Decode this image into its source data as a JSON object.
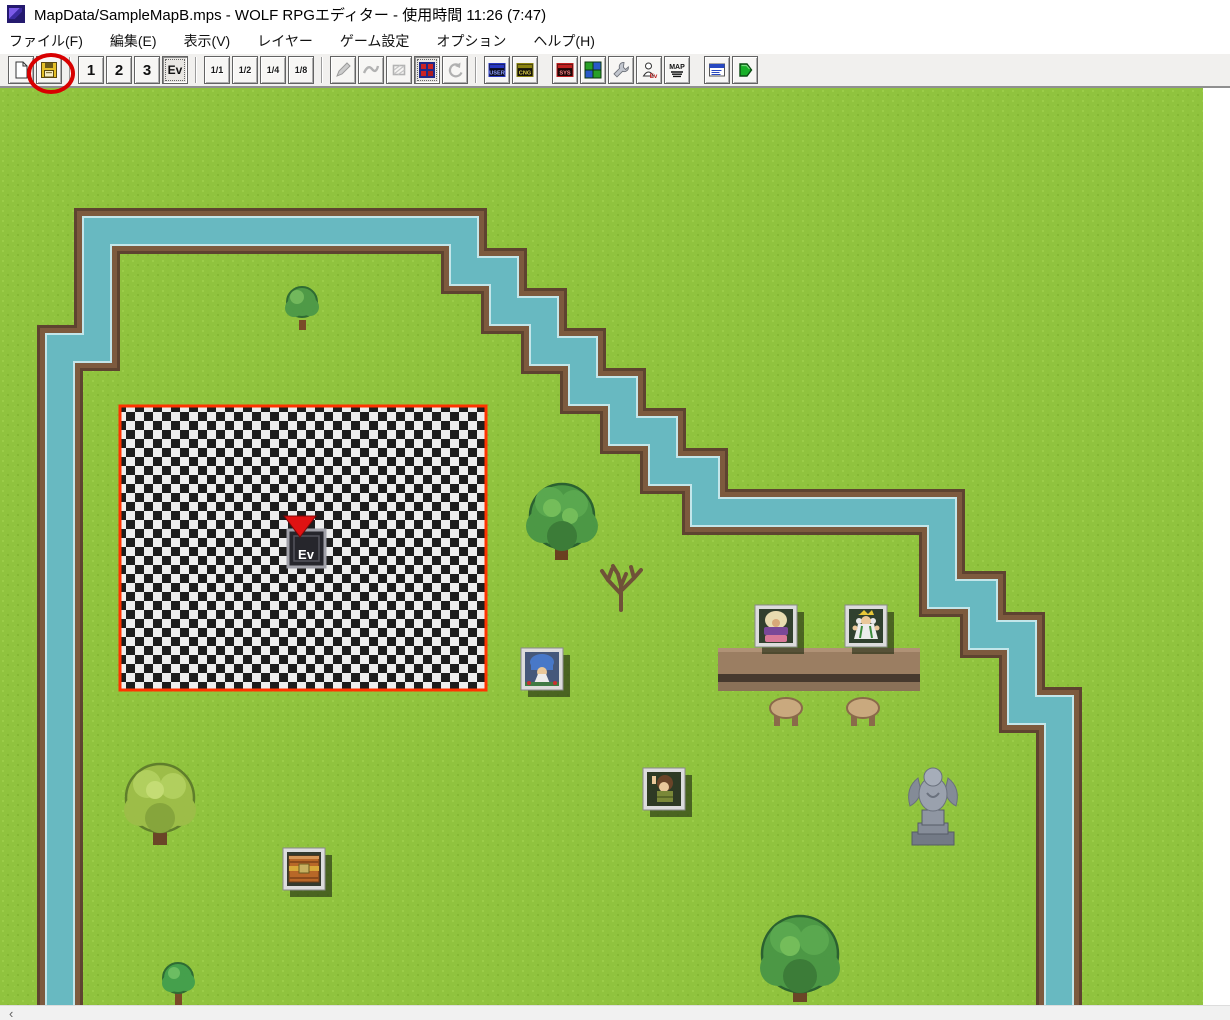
{
  "window": {
    "title": "MapData/SampleMapB.mps - WOLF RPGエディター - 使用時間 11:26 (7:47)"
  },
  "menu": {
    "items": [
      "ファイル(F)",
      "編集(E)",
      "表示(V)",
      "レイヤー",
      "ゲーム設定",
      "オプション",
      "ヘルプ(H)"
    ]
  },
  "toolbar": {
    "layer1_label": "1",
    "layer2_label": "2",
    "layer3_label": "3",
    "event_layer_label": "Ev",
    "zoom_labels": [
      "1/1",
      "1/2",
      "1/4",
      "1/8"
    ],
    "db_user_label": "USER",
    "db_change_label": "CNG",
    "db_system_label": "SYS",
    "map_button_label": "MAP",
    "event_search_label": "Ev"
  },
  "map": {
    "event_cursor_label": "Ev"
  },
  "scrollbar": {
    "left_arrow": "‹"
  },
  "colors": {
    "grass": "#90c33e",
    "water": "#68b9c1",
    "bank": "#7d5a3e",
    "selection_border": "#ff3300",
    "annotation_red": "#d80000"
  }
}
